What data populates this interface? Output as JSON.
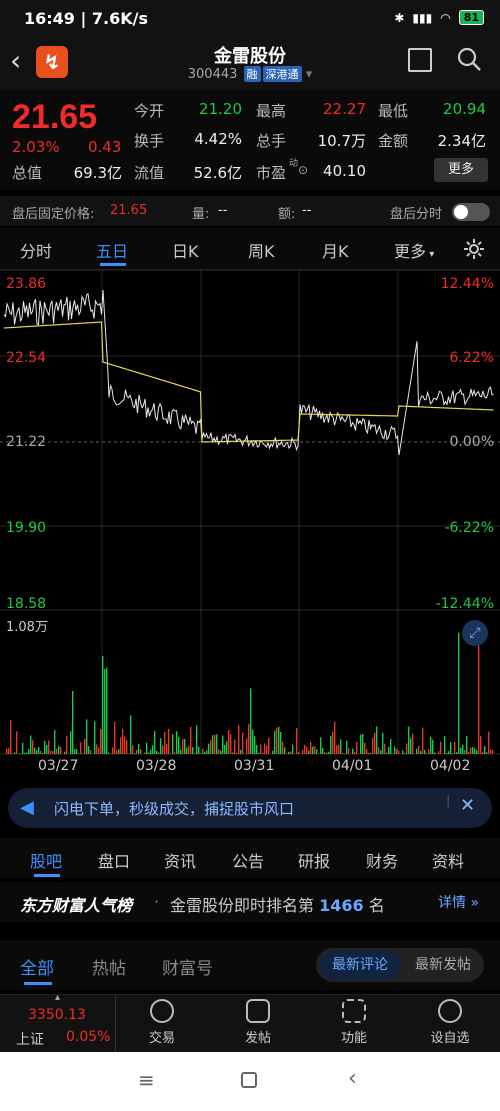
{
  "statusbar": {
    "time": "16:49",
    "speed": "7.6K/s",
    "battery": "81"
  },
  "header": {
    "name": "金雷股份",
    "code": "300443",
    "tag1": "融",
    "tag2": "深港通"
  },
  "quote": {
    "price": "21.65",
    "chg_pct": "2.03%",
    "chg_abs": "0.43",
    "rows": [
      [
        {
          "l": "今开",
          "v": "21.20",
          "c": "green"
        },
        {
          "l": "最高",
          "v": "22.27",
          "c": "red"
        },
        {
          "l": "最低",
          "v": "20.94",
          "c": "green"
        }
      ],
      [
        {
          "l": "换手",
          "v": "4.42%",
          "c": "white"
        },
        {
          "l": "总手",
          "v": "10.7万",
          "c": "white"
        },
        {
          "l": "金额",
          "v": "2.34亿",
          "c": "white"
        }
      ]
    ],
    "mktcap_label": "总值",
    "mktcap": "69.3亿",
    "float_label": "流值",
    "float": "52.6亿",
    "pe_label": "市盈",
    "pe_sup": "动",
    "pe": "40.10",
    "more": "更多"
  },
  "afterhours": {
    "label": "盘后固定价格:",
    "price": "21.65",
    "vol_label": "量:",
    "vol": "--",
    "amt_label": "额:",
    "amt": "--",
    "timeshare": "盘后分时"
  },
  "tabs": [
    "分时",
    "五日",
    "日K",
    "周K",
    "月K",
    "更多"
  ],
  "chart": {
    "y_left": [
      "23.86",
      "22.54",
      "21.22",
      "19.90",
      "18.58"
    ],
    "y_right": [
      "12.44%",
      "6.22%",
      "0.00%",
      "-6.22%",
      "-12.44%"
    ],
    "vol_label": "1.08万",
    "dates": [
      "03/27",
      "03/28",
      "03/31",
      "04/01",
      "04/02"
    ]
  },
  "ad": {
    "text": "闪电下单，秒级成交，捕捉股市风口"
  },
  "subtabs": [
    "股吧",
    "盘口",
    "资讯",
    "公告",
    "研报",
    "财务",
    "资料"
  ],
  "rank": {
    "title": "东方财富人气榜",
    "text": "金雷股份即时排名第",
    "num": "1466",
    "unit": "名",
    "detail": "详情"
  },
  "feedtabs": {
    "tabs": [
      "全部",
      "热帖",
      "财富号"
    ],
    "sort1": "最新评论",
    "sort2": "最新发帖"
  },
  "bottomnav": {
    "index_val": "3350.13",
    "index_name": "上证",
    "index_pct": "0.05%",
    "items": [
      "交易",
      "发帖",
      "功能",
      "设自选"
    ]
  }
}
